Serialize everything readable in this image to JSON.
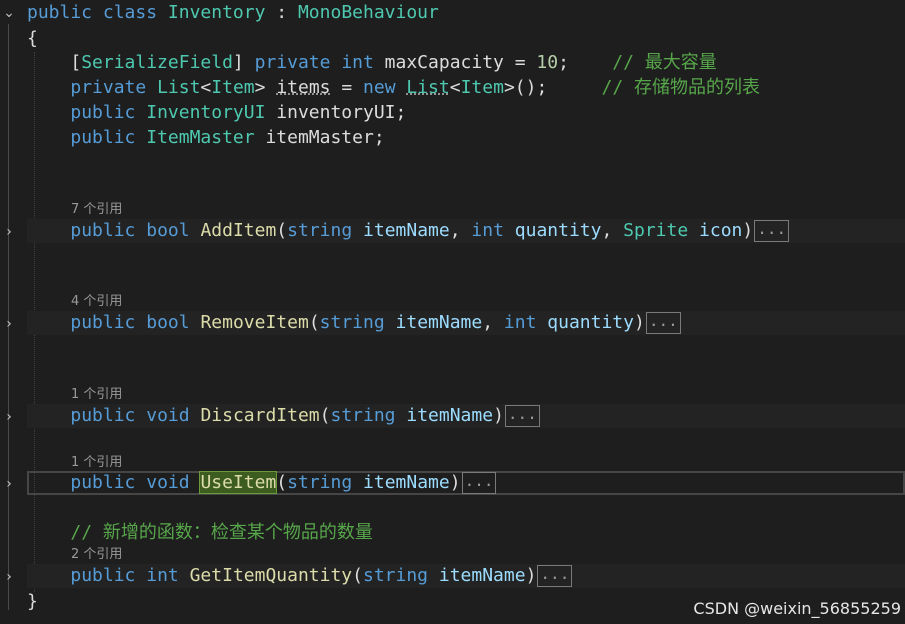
{
  "code": {
    "class_decl": {
      "kw_public": "public",
      "kw_class": "class",
      "class_name": "Inventory",
      "colon": " : ",
      "base": "MonoBehaviour"
    },
    "open_brace": "{",
    "close_brace": "}",
    "field1": {
      "attr_open": "[",
      "attr": "SerializeField",
      "attr_close": "]",
      "kw_private": "private",
      "kw_int": "int",
      "name": "maxCapacity = ",
      "value": "10",
      "semi": ";",
      "comment": "// 最大容量"
    },
    "field2": {
      "kw_private": "private",
      "type_list": "List",
      "lt": "<",
      "type_item": "Item",
      "gt": "> ",
      "name": "items",
      "eq": " = ",
      "kw_new": "new",
      "type_list2": "List",
      "lt2": "<",
      "type_item2": "Item",
      "rest": ">();",
      "comment": "// 存储物品的列表"
    },
    "field3": {
      "kw_public": "public",
      "type": "InventoryUI",
      "name": " inventoryUI;"
    },
    "field4": {
      "kw_public": "public",
      "type": "ItemMaster",
      "name": " itemMaster;"
    },
    "methods": [
      {
        "refs": "7 个引用",
        "kw_public": "public",
        "ret": "bool",
        "name": "AddItem",
        "open": "(",
        "p1_type": "string",
        "p1_name": "itemName",
        "sep1": ", ",
        "p2_type": "int",
        "p2_name": "quantity",
        "sep2": ", ",
        "p3_type": "Sprite",
        "p3_name": "icon",
        "close": ")",
        "collapsed": "..."
      },
      {
        "refs": "4 个引用",
        "kw_public": "public",
        "ret": "bool",
        "name": "RemoveItem",
        "open": "(",
        "p1_type": "string",
        "p1_name": "itemName",
        "sep1": ", ",
        "p2_type": "int",
        "p2_name": "quantity",
        "close": ")",
        "collapsed": "..."
      },
      {
        "refs": "1 个引用",
        "kw_public": "public",
        "ret": "void",
        "name": "DiscardItem",
        "open": "(",
        "p1_type": "string",
        "p1_name": "itemName",
        "close": ")",
        "collapsed": "..."
      },
      {
        "refs": "1 个引用",
        "kw_public": "public",
        "ret": "void",
        "name": "UseItem",
        "open": "(",
        "p1_type": "string",
        "p1_name": "itemName",
        "close": ")",
        "collapsed": "..."
      },
      {
        "comment": "// 新增的函数：检查某个物品的数量",
        "refs": "2 个引用",
        "kw_public": "public",
        "ret": "int",
        "name": "GetItemQuantity",
        "open": "(",
        "p1_type": "string",
        "p1_name": "itemName",
        "close": ")",
        "collapsed": "..."
      }
    ]
  },
  "watermark": "CSDN @weixin_56855259",
  "icons": {
    "fold_expanded": "chevron-down-icon",
    "fold_collapsed": "chevron-right-icon"
  },
  "colors": {
    "background": "#1e1e1e",
    "keyword": "#569cd6",
    "type": "#4ec9b0",
    "method": "#dcdcaa",
    "parameter": "#9cdcfe",
    "comment": "#57a64a",
    "number": "#b5cea8"
  }
}
